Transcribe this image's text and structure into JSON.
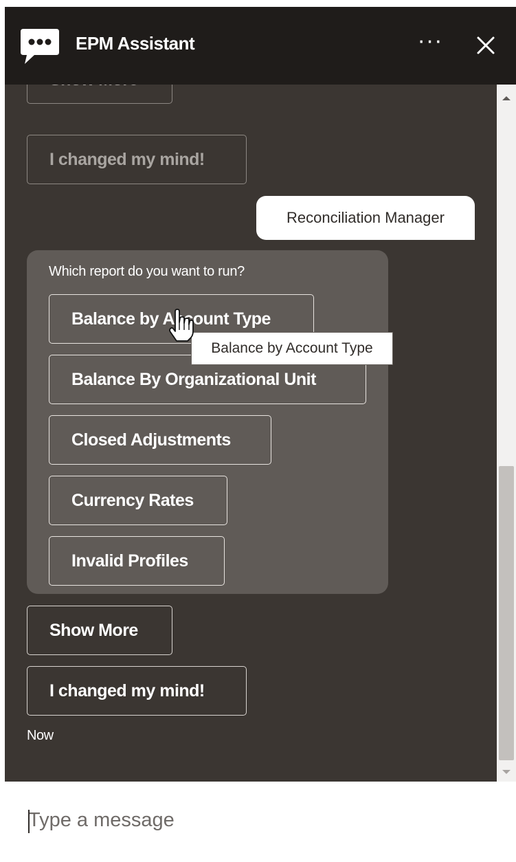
{
  "header": {
    "title": "EPM Assistant",
    "more_icon": "ellipsis-icon",
    "more_label": "···",
    "close_icon": "close-icon",
    "logo_icon": "chat-bubble-icon"
  },
  "conversation": {
    "previous_options": {
      "show_more": "Show More",
      "changed_mind": "I changed my mind!"
    },
    "user_message": "Reconciliation Manager",
    "bot_message": {
      "question": "Which report do you want to run?",
      "options": [
        "Balance by Account Type",
        "Balance By Organizational Unit",
        "Closed Adjustments",
        "Currency Rates",
        "Invalid Profiles"
      ]
    },
    "show_more": "Show More",
    "changed_mind": "I changed my mind!",
    "timestamp": "Now"
  },
  "tooltip": {
    "text": "Balance by Account Type"
  },
  "cursor": {
    "icon": "hand-pointer-icon"
  },
  "composer": {
    "placeholder": "Type a message"
  },
  "colors": {
    "header_bg": "#1f1c1a",
    "chat_bg": "#3b3632",
    "bot_bubble_bg": "#605b57",
    "user_bubble_bg": "#ffffff",
    "text_light": "#ffffff",
    "text_dark": "#312d2a"
  }
}
